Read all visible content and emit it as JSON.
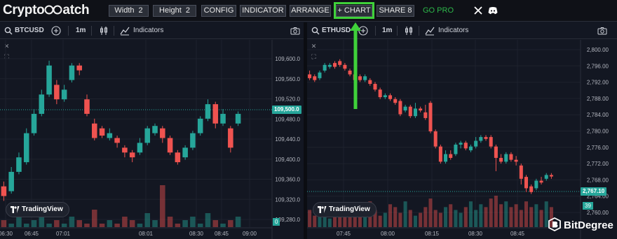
{
  "nav": {
    "logo_text_left": "Crypto",
    "logo_text_right": "atch",
    "width_label": "Width",
    "width_value": "2",
    "height_label": "Height",
    "height_value": "2",
    "config_label": "CONFIG",
    "indicator_label": "INDICATOR",
    "arrange_label": "ARRANGE",
    "add_chart_label": "+ CHART",
    "share_label": "SHARE 8",
    "gopro_label": "GO PRO",
    "icons": [
      "x-icon",
      "discord-icon"
    ],
    "highlight_color": "#3fd13a"
  },
  "left_chart": {
    "symbol": "BTCUSD",
    "interval": "1m",
    "indicators_label": "Indicators",
    "price_axis": [
      "109,600.0",
      "109,560.0",
      "109,520.0",
      "109,480.0",
      "109,440.0",
      "109,400.0",
      "109,360.0",
      "109,320.0",
      "109,280.0"
    ],
    "last_price": "109,500.0",
    "time_axis": [
      "06:30",
      "06:45",
      "07:01",
      "08:01",
      "08:30",
      "08:45",
      "09:00"
    ],
    "volume_tag": "0",
    "tradingview_label": "TradingView",
    "price_range": [
      109270,
      109630
    ],
    "candles": [
      {
        "o": 109350,
        "c": 109330,
        "h": 109360,
        "l": 109320
      },
      {
        "o": 109340,
        "c": 109380,
        "h": 109390,
        "l": 109335
      },
      {
        "o": 109380,
        "c": 109410,
        "h": 109420,
        "l": 109375
      },
      {
        "o": 109400,
        "c": 109460,
        "h": 109470,
        "l": 109395
      },
      {
        "o": 109460,
        "c": 109500,
        "h": 109510,
        "l": 109455
      },
      {
        "o": 109500,
        "c": 109540,
        "h": 109550,
        "l": 109495
      },
      {
        "o": 109540,
        "c": 109600,
        "h": 109610,
        "l": 109535
      },
      {
        "o": 109560,
        "c": 109530,
        "h": 109570,
        "l": 109520
      },
      {
        "o": 109530,
        "c": 109550,
        "h": 109560,
        "l": 109525
      },
      {
        "o": 109570,
        "c": 109600,
        "h": 109605,
        "l": 109565
      },
      {
        "o": 109600,
        "c": 109590,
        "h": 109605,
        "l": 109580
      },
      {
        "o": 109530,
        "c": 109500,
        "h": 109540,
        "l": 109495
      },
      {
        "o": 109480,
        "c": 109450,
        "h": 109490,
        "l": 109445
      },
      {
        "o": 109470,
        "c": 109455,
        "h": 109475,
        "l": 109450
      },
      {
        "o": 109450,
        "c": 109460,
        "h": 109470,
        "l": 109445
      },
      {
        "o": 109450,
        "c": 109440,
        "h": 109455,
        "l": 109430
      },
      {
        "o": 109430,
        "c": 109420,
        "h": 109435,
        "l": 109410
      },
      {
        "o": 109420,
        "c": 109410,
        "h": 109425,
        "l": 109400
      },
      {
        "o": 109420,
        "c": 109440,
        "h": 109450,
        "l": 109415
      },
      {
        "o": 109440,
        "c": 109470,
        "h": 109475,
        "l": 109435
      },
      {
        "o": 109460,
        "c": 109475,
        "h": 109480,
        "l": 109455
      },
      {
        "o": 109470,
        "c": 109450,
        "h": 109475,
        "l": 109440
      },
      {
        "o": 109450,
        "c": 109420,
        "h": 109455,
        "l": 109415
      },
      {
        "o": 109420,
        "c": 109400,
        "h": 109425,
        "l": 109395
      },
      {
        "o": 109410,
        "c": 109430,
        "h": 109435,
        "l": 109405
      },
      {
        "o": 109430,
        "c": 109460,
        "h": 109465,
        "l": 109425
      },
      {
        "o": 109460,
        "c": 109490,
        "h": 109495,
        "l": 109455
      },
      {
        "o": 109490,
        "c": 109520,
        "h": 109530,
        "l": 109485
      },
      {
        "o": 109520,
        "c": 109480,
        "h": 109525,
        "l": 109470
      },
      {
        "o": 109480,
        "c": 109500,
        "h": 109510,
        "l": 109475
      },
      {
        "o": 109470,
        "c": 109430,
        "h": 109475,
        "l": 109420
      },
      {
        "o": 109480,
        "c": 109500,
        "h": 109505,
        "l": 109475
      }
    ],
    "volumes": [
      2,
      1,
      3,
      1,
      2,
      4,
      1,
      2,
      1,
      3,
      2,
      1,
      5,
      1,
      2,
      1,
      3,
      2,
      1,
      4,
      2,
      12,
      3,
      1,
      2,
      3,
      1,
      4,
      2,
      1,
      2,
      3
    ]
  },
  "right_chart": {
    "symbol": "ETHUSD",
    "interval": "1m",
    "indicators_label": "Indicators",
    "price_axis": [
      "2,800.00",
      "2,796.00",
      "2,792.00",
      "2,788.00",
      "2,784.00",
      "2,780.00",
      "2,776.00",
      "2,772.00",
      "2,768.00",
      "2,764.00",
      "2,760.00"
    ],
    "last_price": "2,767.10",
    "volume_tag": "39",
    "time_axis": [
      "07:45",
      "08:00",
      "08:15",
      "08:30",
      "08:45"
    ],
    "tradingview_label": "TradingView",
    "price_range": [
      2758,
      2802
    ],
    "candles": [
      {
        "o": 2794.0,
        "c": 2793.0,
        "h": 2795.0,
        "l": 2792.5
      },
      {
        "o": 2793.5,
        "c": 2792.5,
        "h": 2794.0,
        "l": 2792.0
      },
      {
        "o": 2793.0,
        "c": 2794.5,
        "h": 2795.0,
        "l": 2792.5
      },
      {
        "o": 2795.0,
        "c": 2796.5,
        "h": 2797.0,
        "l": 2794.5
      },
      {
        "o": 2796.0,
        "c": 2796.5,
        "h": 2797.0,
        "l": 2795.5
      },
      {
        "o": 2797.0,
        "c": 2796.0,
        "h": 2797.5,
        "l": 2795.5
      },
      {
        "o": 2797.5,
        "c": 2796.5,
        "h": 2798.0,
        "l": 2796.0
      },
      {
        "o": 2796.5,
        "c": 2795.5,
        "h": 2797.0,
        "l": 2795.0
      },
      {
        "o": 2795.0,
        "c": 2794.0,
        "h": 2795.5,
        "l": 2793.5
      },
      {
        "o": 2794.0,
        "c": 2792.5,
        "h": 2794.5,
        "l": 2792.0
      },
      {
        "o": 2793.5,
        "c": 2792.5,
        "h": 2794.0,
        "l": 2792.0
      },
      {
        "o": 2792.5,
        "c": 2793.5,
        "h": 2794.0,
        "l": 2792.0
      },
      {
        "o": 2792.5,
        "c": 2791.5,
        "h": 2793.0,
        "l": 2791.0
      },
      {
        "o": 2791.5,
        "c": 2790.0,
        "h": 2792.0,
        "l": 2789.5
      },
      {
        "o": 2790.0,
        "c": 2788.0,
        "h": 2790.5,
        "l": 2787.5
      },
      {
        "o": 2788.0,
        "c": 2788.5,
        "h": 2789.0,
        "l": 2787.5
      },
      {
        "o": 2788.5,
        "c": 2787.5,
        "h": 2789.0,
        "l": 2787.0
      },
      {
        "o": 2787.5,
        "c": 2786.5,
        "h": 2788.0,
        "l": 2786.0
      },
      {
        "o": 2787.0,
        "c": 2783.5,
        "h": 2787.5,
        "l": 2783.0
      },
      {
        "o": 2784.5,
        "c": 2785.5,
        "h": 2786.0,
        "l": 2784.0
      },
      {
        "o": 2785.5,
        "c": 2783.0,
        "h": 2786.0,
        "l": 2782.5
      },
      {
        "o": 2783.0,
        "c": 2785.0,
        "h": 2786.5,
        "l": 2782.5
      },
      {
        "o": 2785.0,
        "c": 2784.5,
        "h": 2785.5,
        "l": 2784.0
      },
      {
        "o": 2784.0,
        "c": 2782.5,
        "h": 2786.0,
        "l": 2782.0
      },
      {
        "o": 2786.5,
        "c": 2779.0,
        "h": 2787.0,
        "l": 2778.5
      },
      {
        "o": 2779.0,
        "c": 2775.0,
        "h": 2779.5,
        "l": 2774.5
      },
      {
        "o": 2775.0,
        "c": 2771.0,
        "h": 2775.5,
        "l": 2770.5
      },
      {
        "o": 2771.0,
        "c": 2773.0,
        "h": 2774.0,
        "l": 2770.5
      },
      {
        "o": 2773.0,
        "c": 2772.0,
        "h": 2774.0,
        "l": 2771.5
      },
      {
        "o": 2773.0,
        "c": 2775.5,
        "h": 2776.0,
        "l": 2772.5
      },
      {
        "o": 2775.5,
        "c": 2776.0,
        "h": 2776.5,
        "l": 2774.5
      },
      {
        "o": 2776.0,
        "c": 2774.5,
        "h": 2776.5,
        "l": 2774.0
      },
      {
        "o": 2774.0,
        "c": 2775.0,
        "h": 2775.5,
        "l": 2773.5
      },
      {
        "o": 2775.0,
        "c": 2776.5,
        "h": 2777.5,
        "l": 2774.5
      },
      {
        "o": 2776.5,
        "c": 2777.5,
        "h": 2778.0,
        "l": 2776.0
      },
      {
        "o": 2777.5,
        "c": 2777.0,
        "h": 2778.0,
        "l": 2776.5
      },
      {
        "o": 2777.5,
        "c": 2775.0,
        "h": 2778.0,
        "l": 2774.5
      },
      {
        "o": 2775.0,
        "c": 2772.0,
        "h": 2775.5,
        "l": 2768.5
      },
      {
        "o": 2772.0,
        "c": 2771.0,
        "h": 2773.0,
        "l": 2770.5
      },
      {
        "o": 2771.0,
        "c": 2773.0,
        "h": 2773.5,
        "l": 2770.5
      },
      {
        "o": 2773.0,
        "c": 2771.5,
        "h": 2773.5,
        "l": 2771.0
      },
      {
        "o": 2771.5,
        "c": 2771.0,
        "h": 2772.5,
        "l": 2770.0
      },
      {
        "o": 2770.0,
        "c": 2766.5,
        "h": 2770.5,
        "l": 2765.0
      },
      {
        "o": 2767.0,
        "c": 2764.0,
        "h": 2767.5,
        "l": 2763.0
      },
      {
        "o": 2764.5,
        "c": 2763.0,
        "h": 2765.0,
        "l": 2762.5
      },
      {
        "o": 2764.0,
        "c": 2766.0,
        "h": 2766.5,
        "l": 2763.5
      },
      {
        "o": 2766.0,
        "c": 2765.5,
        "h": 2767.0,
        "l": 2765.0
      },
      {
        "o": 2766.5,
        "c": 2767.5,
        "h": 2768.0,
        "l": 2766.0
      },
      {
        "o": 2767.5,
        "c": 2767.1,
        "h": 2768.0,
        "l": 2766.5
      }
    ],
    "volumes": [
      6,
      4,
      5,
      7,
      3,
      4,
      6,
      5,
      8,
      7,
      6,
      5,
      9,
      6,
      4,
      5,
      8,
      7,
      5,
      9,
      6,
      4,
      5,
      7,
      10,
      6,
      5,
      7,
      8,
      6,
      5,
      7,
      9,
      6,
      8,
      7,
      10,
      11,
      8,
      9,
      7,
      8,
      6,
      9,
      7,
      8,
      6,
      9,
      7
    ]
  },
  "colors": {
    "up": "#26a69a",
    "down": "#ef5350",
    "background": "#131722",
    "grid": "#1e222d",
    "arrow": "#3fd13a"
  },
  "watermark": "BitDegree"
}
